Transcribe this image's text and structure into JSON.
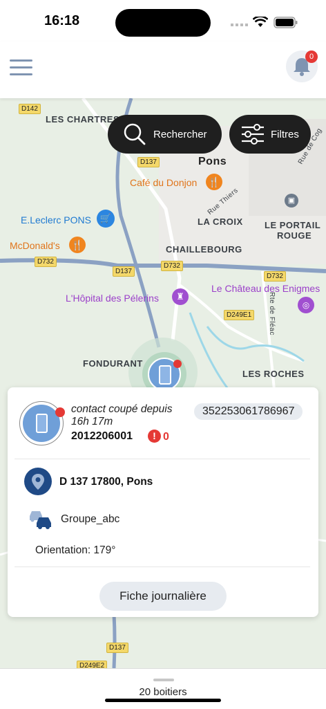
{
  "status_bar": {
    "time": "16:18"
  },
  "header": {
    "notification_count": "0"
  },
  "search": {
    "label": "Rechercher"
  },
  "filters": {
    "label": "Filtres"
  },
  "map": {
    "places": [
      "LES CHARTRES",
      "Pons",
      "LA CROIX",
      "CHAILLEBOURG",
      "LE PORTAIL",
      "ROUGE",
      "FONDURANT",
      "LES ROCHES",
      "Rue Thiers",
      "Rte de Fléac",
      "Rue de Cog"
    ],
    "pois": [
      "Café du Donjon",
      "E.Leclerc PONS",
      "McDonald's",
      "L'Hôpital des Pélerins",
      "Le Château des Enigmes"
    ],
    "roads": [
      "D142",
      "D137",
      "D732",
      "D137",
      "D732",
      "D732",
      "D249E1",
      "D137",
      "D249E2"
    ]
  },
  "device": {
    "status_text": "contact coupé depuis 16h 17m",
    "id": "2012206001",
    "alert_count": "0",
    "imei": "352253061786967",
    "address": "D 137 17800, Pons",
    "group": "Groupe_abc",
    "orientation": "Orientation: 179°",
    "daily_sheet_label": "Fiche journalière"
  },
  "footer": {
    "count_label": "20 boitiers"
  },
  "colors": {
    "accent": "#1f4a86",
    "alert": "#e53935",
    "device_blue": "#6f9fd8"
  }
}
